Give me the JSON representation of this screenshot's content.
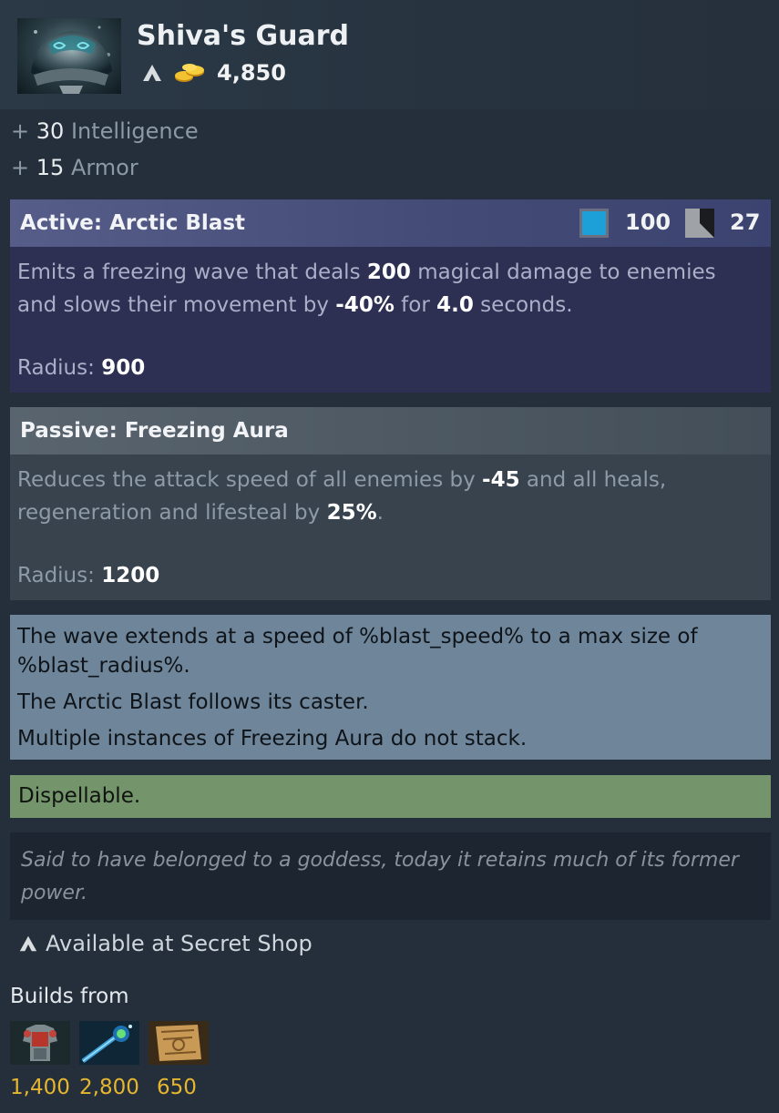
{
  "item": {
    "name": "Shiva's Guard",
    "cost": "4,850",
    "icon": "shivas-guard-icon"
  },
  "stats": [
    {
      "prefix": "+",
      "value": "30",
      "label": "Intelligence"
    },
    {
      "prefix": "+",
      "value": "15",
      "label": "Armor"
    }
  ],
  "active": {
    "title": "Active: Arctic Blast",
    "mana_cost": "100",
    "cooldown": "27",
    "desc_parts": [
      "Emits a freezing wave that deals ",
      "200",
      " magical damage to enemies and slows their movement by ",
      "-40%",
      " for ",
      "4.0",
      " seconds."
    ],
    "radius_label": "Radius:",
    "radius_value": "900"
  },
  "passive": {
    "title": "Passive: Freezing Aura",
    "desc_parts": [
      "Reduces the attack speed of all enemies by ",
      "-45",
      " and all heals, regeneration and lifesteal by ",
      "25%",
      "."
    ],
    "radius_label": "Radius:",
    "radius_value": "1200"
  },
  "notes": [
    "The wave extends at a speed of %blast_speed% to a max size of %blast_radius%.",
    "The Arctic Blast follows its caster.",
    "Multiple instances of Freezing Aura do not stack."
  ],
  "dispel": "Dispellable.",
  "lore": "Said to have belonged to a goddess, today it retains much of its former power.",
  "secret_shop": "Available at Secret Shop",
  "builds": {
    "label": "Builds from",
    "components": [
      {
        "icon": "platemail-icon",
        "cost": "1,400"
      },
      {
        "icon": "mystic-staff-icon",
        "cost": "2,800"
      },
      {
        "icon": "recipe-scroll-icon",
        "cost": "650"
      }
    ]
  },
  "colors": {
    "active_header": "#4b5280",
    "active_body": "#2d3052",
    "passive_header": "#515c66",
    "passive_body": "#38434e",
    "notes_bg": "#6f8599",
    "dispel_bg": "#74946c",
    "lore_bg": "#1d2630",
    "gold": "#e6b62e",
    "mana": "#1d9fd8"
  }
}
